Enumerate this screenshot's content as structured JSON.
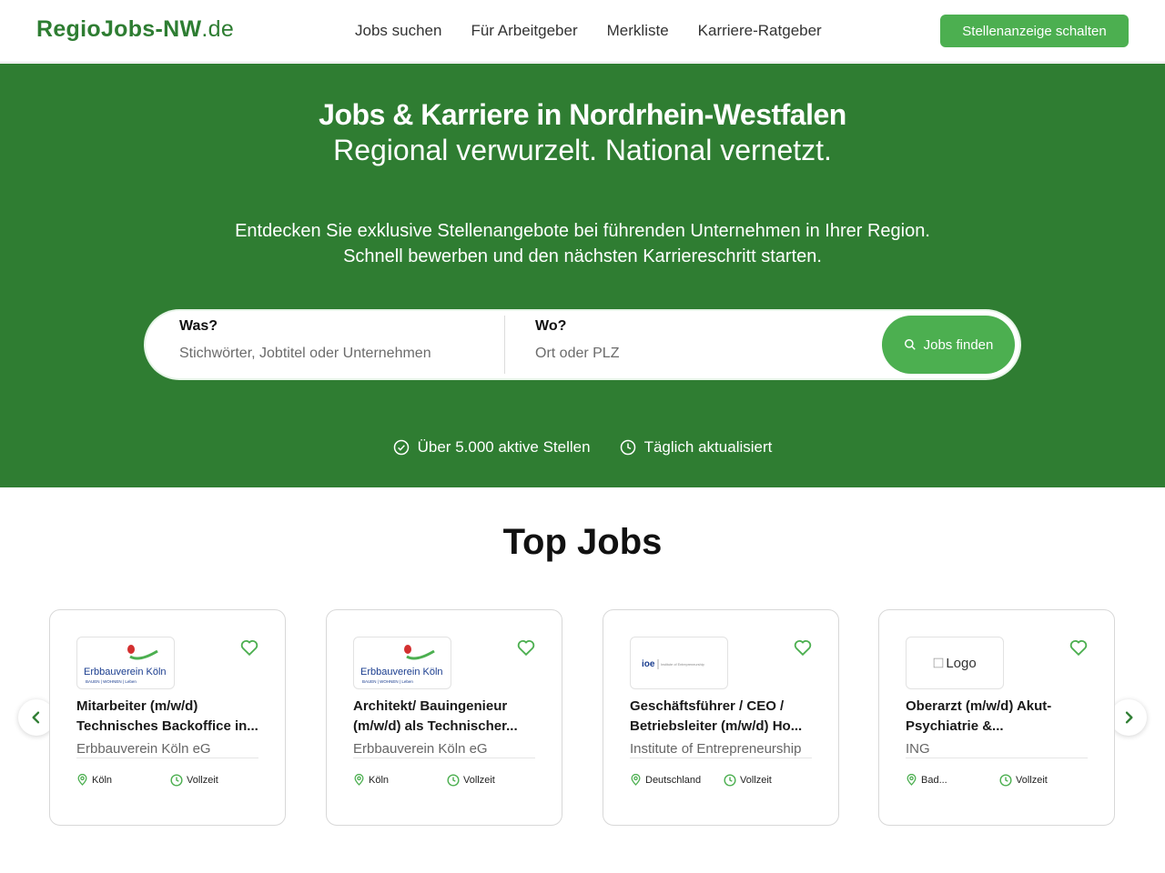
{
  "header": {
    "logo_brand": "RegioJobs-NW",
    "logo_tld": ".de",
    "nav": [
      "Jobs suchen",
      "Für Arbeitgeber",
      "Merkliste",
      "Karriere-Ratgeber"
    ],
    "cta_label": "Stellenanzeige schalten"
  },
  "hero": {
    "title": "Jobs & Karriere in Nordrhein-Westfalen",
    "subtitle": "Regional verwurzelt. National vernetzt.",
    "desc_line1": "Entdecken Sie exklusive Stellenangebote bei führenden Unternehmen in Ihrer Region.",
    "desc_line2": "Schnell bewerben und den nächsten Karriereschritt starten."
  },
  "search": {
    "what_label": "Was?",
    "what_placeholder": "Stichwörter, Jobtitel oder Unternehmen",
    "where_label": "Wo?",
    "where_placeholder": "Ort oder PLZ",
    "button_label": "Jobs finden"
  },
  "badges": [
    "Über 5.000 aktive Stellen",
    "Täglich aktualisiert"
  ],
  "top_jobs": {
    "title": "Top Jobs",
    "cards": [
      {
        "logo": "Erbbauverein Köln",
        "logo_sub": "BAUEN | WOHNEN | Leben",
        "title_l1": "Mitarbeiter (m/w/d)",
        "title_l2": "Technisches Backoffice in...",
        "company": "Erbbauverein Köln eG",
        "location": "Köln",
        "type": "Vollzeit"
      },
      {
        "logo": "Erbbauverein Köln",
        "logo_sub": "BAUEN | WOHNEN | Leben",
        "title_l1": "Architekt/ Bauingenieur",
        "title_l2": "(m/w/d) als Technischer...",
        "company": "Erbbauverein Köln eG",
        "location": "Köln",
        "type": "Vollzeit"
      },
      {
        "logo": "ioe",
        "logo_sub": "Institute of Entrepreneurship",
        "title_l1": "Geschäftsführer / CEO /",
        "title_l2": "Betriebsleiter (m/w/d) Ho...",
        "company": "Institute of Entrepreneurship",
        "location": "Deutschland",
        "type": "Vollzeit"
      },
      {
        "logo": "Logo",
        "logo_sub": "",
        "title_l1": "Oberarzt (m/w/d) Akut-",
        "title_l2": "Psychiatrie &...",
        "company": "ING",
        "location": "Bad...",
        "type": "Vollzeit"
      }
    ]
  },
  "colors": {
    "primary": "#2f7d32",
    "accent": "#4caf50",
    "logo_blue": "#1a3d8f",
    "logo_red": "#d32f2f"
  }
}
